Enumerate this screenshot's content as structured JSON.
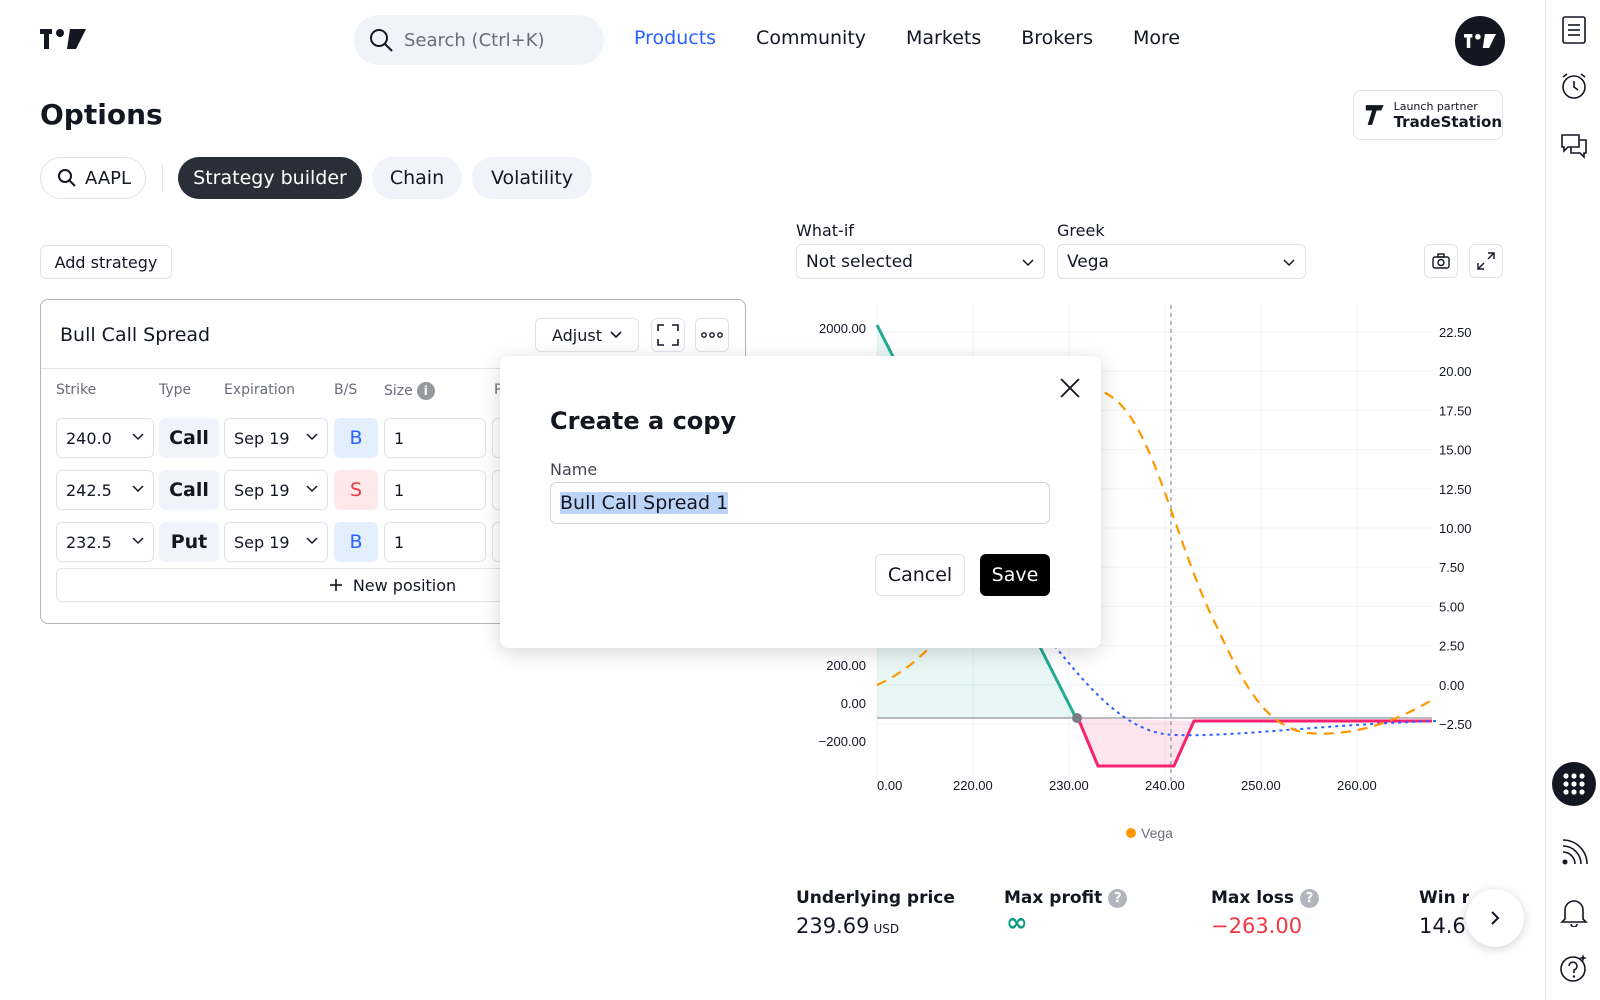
{
  "header": {
    "search_placeholder": "Search (Ctrl+K)",
    "nav": [
      "Products",
      "Community",
      "Markets",
      "Brokers",
      "More"
    ],
    "active_nav": "Products"
  },
  "page": {
    "title": "Options",
    "partner_small": "Launch partner",
    "partner_name": "TradeStation"
  },
  "tabs": {
    "symbol": "AAPL",
    "items": [
      "Strategy builder",
      "Chain",
      "Volatility"
    ],
    "active": "Strategy builder"
  },
  "strategy": {
    "add_label": "Add strategy",
    "name": "Bull Call Spread",
    "adjust_label": "Adjust",
    "columns": [
      "Strike",
      "Type",
      "Expiration",
      "B/S",
      "Size",
      "P"
    ],
    "rows": [
      {
        "strike": "240.0",
        "type": "Call",
        "expiration": "Sep 19",
        "bs": "B",
        "size": "1"
      },
      {
        "strike": "242.5",
        "type": "Call",
        "expiration": "Sep 19",
        "bs": "S",
        "size": "1"
      },
      {
        "strike": "232.5",
        "type": "Put",
        "expiration": "Sep 19",
        "bs": "B",
        "size": "1"
      }
    ],
    "new_position_label": "New position"
  },
  "chart_controls": {
    "whatif_label": "What-if",
    "whatif_value": "Not selected",
    "greek_label": "Greek",
    "greek_value": "Vega"
  },
  "chart_data": {
    "type": "line",
    "x_ticks": [
      "0.00",
      "220.00",
      "230.00",
      "240.00",
      "250.00",
      "260.00"
    ],
    "y_left_ticks": [
      "2000.00",
      "200.00",
      "0.00",
      "−200.00"
    ],
    "y_right_ticks": [
      "22.50",
      "20.00",
      "17.50",
      "15.00",
      "12.50",
      "10.00",
      "7.50",
      "5.00",
      "2.50",
      "0.00",
      "−2.50"
    ],
    "current_price_x": 239.69,
    "legend": [
      "Vega"
    ],
    "colors": {
      "profit": "#22ab94",
      "loss": "#f7226f",
      "vega": "#ff9800",
      "theo": "#2962ff"
    }
  },
  "stats": {
    "underlying_label": "Underlying price",
    "underlying_value": "239.69",
    "underlying_unit": "USD",
    "max_profit_label": "Max profit",
    "max_profit_value": "∞",
    "max_loss_label": "Max loss",
    "max_loss_value": "−263.00",
    "win_label": "Win ra",
    "win_value": "14.6"
  },
  "modal": {
    "title": "Create a copy",
    "name_label": "Name",
    "name_value": "Bull Call Spread 1",
    "cancel_label": "Cancel",
    "save_label": "Save"
  }
}
